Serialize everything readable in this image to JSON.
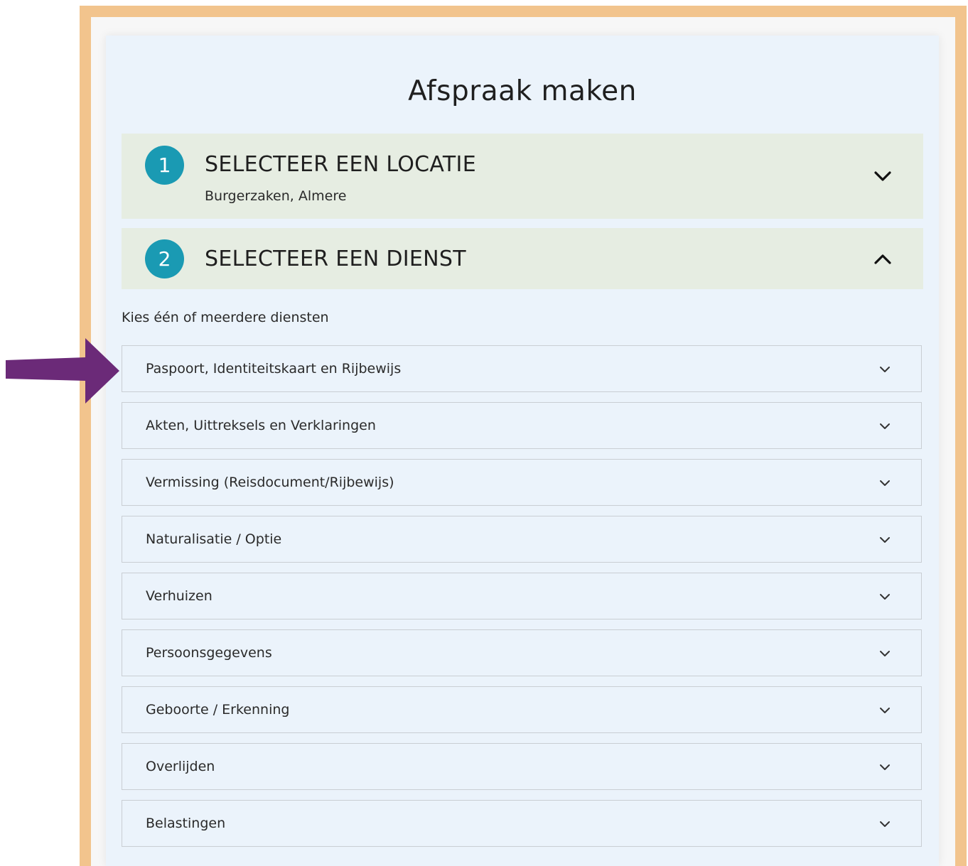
{
  "page": {
    "title": "Afspraak maken"
  },
  "steps": [
    {
      "number": "1",
      "title": "SELECTEER EEN LOCATIE",
      "subtitle": "Burgerzaken, Almere",
      "state": "collapsed"
    },
    {
      "number": "2",
      "title": "SELECTEER EEN DIENST",
      "state": "expanded"
    }
  ],
  "services": {
    "hint": "Kies één of meerdere diensten",
    "items": [
      {
        "label": "Paspoort, Identiteitskaart en Rijbewijs"
      },
      {
        "label": "Akten, Uittreksels en Verklaringen"
      },
      {
        "label": "Vermissing (Reisdocument/Rijbewijs)"
      },
      {
        "label": "Naturalisatie / Optie"
      },
      {
        "label": "Verhuizen"
      },
      {
        "label": "Persoonsgegevens"
      },
      {
        "label": "Geboorte / Erkenning"
      },
      {
        "label": "Overlijden"
      },
      {
        "label": "Belastingen"
      }
    ]
  },
  "annotation": {
    "arrow_color": "#6b2a78",
    "frame_color": "#f2c48d",
    "step_badge_color": "#1a9ab3"
  }
}
